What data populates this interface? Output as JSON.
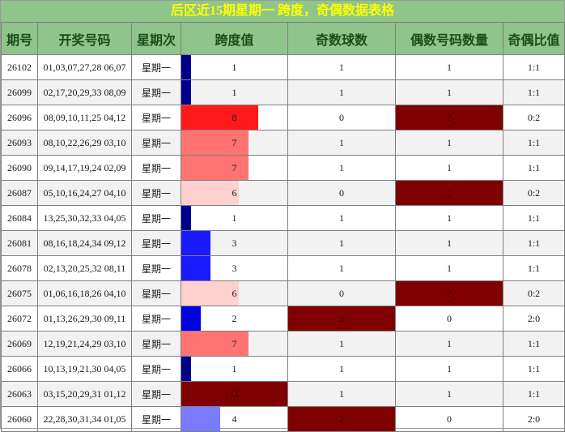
{
  "title": "后区近15期星期一 跨度，奇偶数据表格",
  "headers": [
    "期号",
    "开奖号码",
    "星期次",
    "跨度值",
    "奇数球数",
    "偶数号码数量",
    "奇偶比值"
  ],
  "colors": {
    "header_bg": "#8fc48a",
    "title_text": "#ffff00",
    "header_text": "#1a4d1a",
    "span_1": "#00008b",
    "span_2": "#0000e0",
    "span_3": "#1a1aff",
    "span_4": "#7b7bff",
    "span_6": "#ffd0d0",
    "span_7": "#ff7373",
    "span_8": "#ff1a1a",
    "span_11": "#7f0000",
    "count_highlight": "#7f0000"
  },
  "span_max": 11,
  "count_max": 2,
  "rows": [
    {
      "issue": "26102",
      "numbers": "01,03,07,27,28 06,07",
      "weekday": "星期一",
      "span": 1,
      "odd": 1,
      "even": 1,
      "ratio": "1:1"
    },
    {
      "issue": "26099",
      "numbers": "02,17,20,29,33 08,09",
      "weekday": "星期一",
      "span": 1,
      "odd": 1,
      "even": 1,
      "ratio": "1:1"
    },
    {
      "issue": "26096",
      "numbers": "08,09,10,11,25 04,12",
      "weekday": "星期一",
      "span": 8,
      "odd": 0,
      "even": 2,
      "ratio": "0:2"
    },
    {
      "issue": "26093",
      "numbers": "08,10,22,26,29 03,10",
      "weekday": "星期一",
      "span": 7,
      "odd": 1,
      "even": 1,
      "ratio": "1:1"
    },
    {
      "issue": "26090",
      "numbers": "09,14,17,19,24 02,09",
      "weekday": "星期一",
      "span": 7,
      "odd": 1,
      "even": 1,
      "ratio": "1:1"
    },
    {
      "issue": "26087",
      "numbers": "05,10,16,24,27 04,10",
      "weekday": "星期一",
      "span": 6,
      "odd": 0,
      "even": 2,
      "ratio": "0:2"
    },
    {
      "issue": "26084",
      "numbers": "13,25,30,32,33 04,05",
      "weekday": "星期一",
      "span": 1,
      "odd": 1,
      "even": 1,
      "ratio": "1:1"
    },
    {
      "issue": "26081",
      "numbers": "08,16,18,24,34 09,12",
      "weekday": "星期一",
      "span": 3,
      "odd": 1,
      "even": 1,
      "ratio": "1:1"
    },
    {
      "issue": "26078",
      "numbers": "02,13,20,25,32 08,11",
      "weekday": "星期一",
      "span": 3,
      "odd": 1,
      "even": 1,
      "ratio": "1:1"
    },
    {
      "issue": "26075",
      "numbers": "01,06,16,18,26 04,10",
      "weekday": "星期一",
      "span": 6,
      "odd": 0,
      "even": 2,
      "ratio": "0:2"
    },
    {
      "issue": "26072",
      "numbers": "01,13,26,29,30 09,11",
      "weekday": "星期一",
      "span": 2,
      "odd": 2,
      "even": 0,
      "ratio": "2:0"
    },
    {
      "issue": "26069",
      "numbers": "12,19,21,24,29 03,10",
      "weekday": "星期一",
      "span": 7,
      "odd": 1,
      "even": 1,
      "ratio": "1:1"
    },
    {
      "issue": "26066",
      "numbers": "10,13,19,21,30 04,05",
      "weekday": "星期一",
      "span": 1,
      "odd": 1,
      "even": 1,
      "ratio": "1:1"
    },
    {
      "issue": "26063",
      "numbers": "03,15,20,29,31 01,12",
      "weekday": "星期一",
      "span": 11,
      "odd": 1,
      "even": 1,
      "ratio": "1:1"
    },
    {
      "issue": "26060",
      "numbers": "22,28,30,31,34 01,05",
      "weekday": "星期一",
      "span": 4,
      "odd": 2,
      "even": 0,
      "ratio": "2:0"
    }
  ]
}
